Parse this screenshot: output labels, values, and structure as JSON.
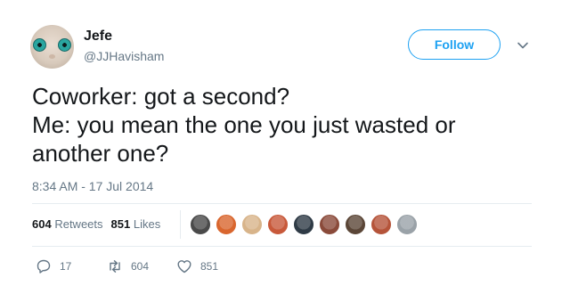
{
  "header": {
    "display_name": "Jefe",
    "handle": "@JJHavisham",
    "follow_label": "Follow",
    "avatar_icon": "user-avatar"
  },
  "tweet": {
    "lines": [
      "Coworker: got a second?",
      "Me: you mean the one you just wasted or",
      "another one?"
    ],
    "timestamp": "8:34 AM - 17 Jul 2014"
  },
  "stats": {
    "retweets_count": "604",
    "retweets_label": "Retweets",
    "likes_count": "851",
    "likes_label": "Likes"
  },
  "likers": [
    {
      "color": "#4a4a4a"
    },
    {
      "color": "#d9662e"
    },
    {
      "color": "#d8b48a"
    },
    {
      "color": "#c8593a"
    },
    {
      "color": "#2f3b46"
    },
    {
      "color": "#8a4a3a"
    },
    {
      "color": "#5b4637"
    },
    {
      "color": "#b5543a"
    },
    {
      "color": "#9aa2a8"
    }
  ],
  "actions": {
    "reply_count": "17",
    "retweet_count": "604",
    "like_count": "851"
  },
  "colors": {
    "accent": "#1da1f2",
    "muted": "#657786",
    "text": "#14171a"
  }
}
